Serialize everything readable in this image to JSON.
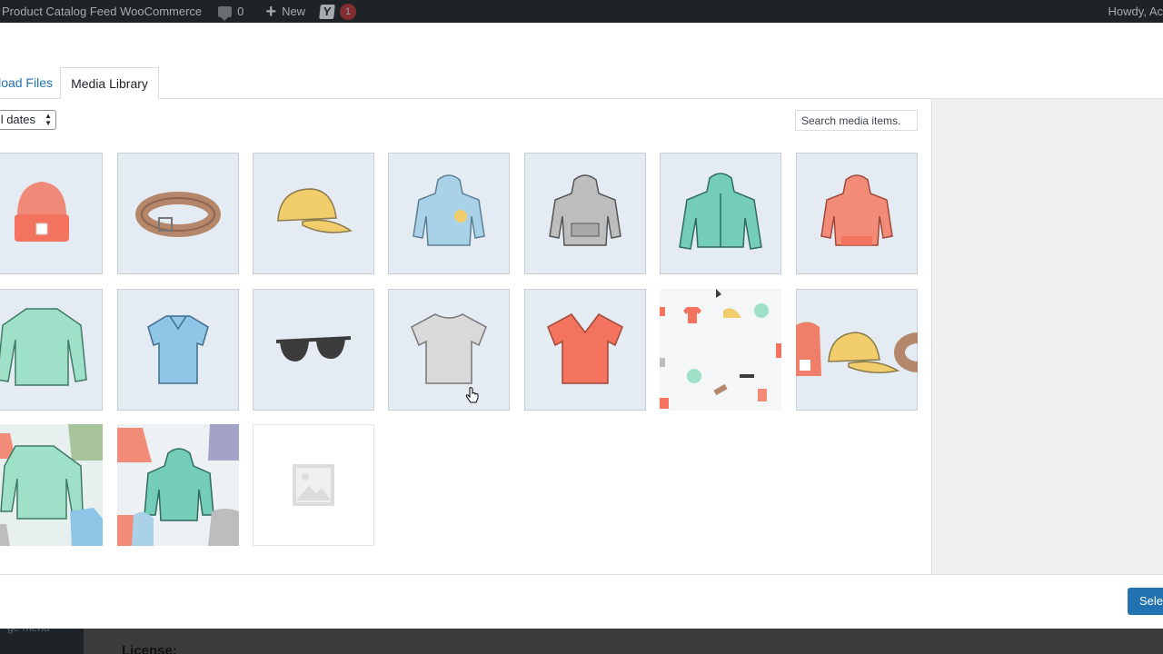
{
  "adminbar": {
    "site_name": "Product Catalog Feed WooCommerce",
    "comments_count": "0",
    "new_label": "New",
    "yoast_icon": "Y",
    "yoast_badge": "1",
    "howdy": "Howdy, Ac"
  },
  "tabs": {
    "upload_label": "load Files",
    "library_label": "Media Library"
  },
  "filters": {
    "date_label": "l dates"
  },
  "search": {
    "placeholder": "Search media items."
  },
  "attachments": [
    {
      "icon": "beanie",
      "color": "#f07f6a"
    },
    {
      "icon": "belt",
      "color": "#b4876a"
    },
    {
      "icon": "cap",
      "color": "#f2cd6c"
    },
    {
      "icon": "hoodie-with-logo",
      "color": "#a9d1e8"
    },
    {
      "icon": "hoodie",
      "color": "#bdbdbd"
    },
    {
      "icon": "hoodie-with-zipper",
      "color": "#74cdb8"
    },
    {
      "icon": "hoodie",
      "color": "#f28b78"
    },
    {
      "icon": "long-sleeve-tee",
      "color": "#9fe0c8"
    },
    {
      "icon": "polo",
      "color": "#8fc5e6"
    },
    {
      "icon": "sunglasses",
      "color": "#3c3c3c"
    },
    {
      "icon": "tshirt",
      "color": "#d9d9d9"
    },
    {
      "icon": "vneck-tee",
      "color": "#f4735e"
    },
    {
      "icon": "pattern-scattered",
      "color": "#f4735e"
    },
    {
      "icon": "banner-beanie-cap-belt",
      "color": "#f2cd6c"
    },
    {
      "icon": "pattern-long-sleeve",
      "color": "#9fe0c8"
    },
    {
      "icon": "pattern-hoodies",
      "color": "#74cdb8"
    },
    {
      "icon": "placeholder-image",
      "color": "#c3c4c7"
    }
  ],
  "footer": {
    "select_label": "Sele"
  },
  "background": {
    "sidebar_text": "ge menu",
    "content_heading": "License:"
  }
}
